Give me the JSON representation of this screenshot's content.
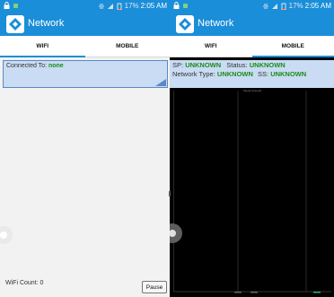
{
  "status_bar": {
    "battery_percent": "17%",
    "time": "2:05 AM"
  },
  "app": {
    "title": "Network"
  },
  "tabs": [
    {
      "label": "WIFI",
      "active": true
    },
    {
      "label": "MOBILE",
      "active": false
    }
  ],
  "right_tabs": [
    {
      "label": "WIFI",
      "active": false
    },
    {
      "label": "MOBILE",
      "active": true
    }
  ],
  "wifi": {
    "connected_label": "Connected To:",
    "connected_value": "none",
    "count_label": "WiFi Count:",
    "count_value": "0",
    "pause_label": "Pause"
  },
  "mobile": {
    "sp_label": "SP:",
    "sp_value": "UNKNOWN",
    "status_label": "Status:",
    "status_value": "UNKNOWN",
    "network_type_label": "Network Type:",
    "network_type_value": "UNKNOWN",
    "ss_label": "SS:",
    "ss_value": "UNKNOWN",
    "chart_title": "Signal Strength"
  },
  "colors": {
    "accent": "#1a8ed8",
    "value_green": "#1b8a1b",
    "info_bg": "#c9dcf3"
  }
}
